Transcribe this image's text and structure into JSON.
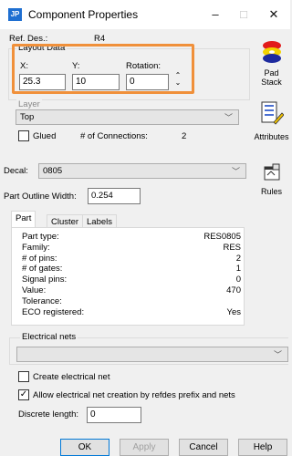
{
  "window": {
    "title": "Component Properties",
    "minimize": "–",
    "maximize": "□",
    "close": "✕"
  },
  "ref_des": {
    "label": "Ref. Des.:",
    "value": "R4"
  },
  "layout_data": {
    "label": "Layout Data",
    "x_label": "X:",
    "x_value": "25.3",
    "y_label": "Y:",
    "y_value": "10",
    "rotation_label": "Rotation:",
    "rotation_value": "0"
  },
  "layer": {
    "label": "Layer",
    "value": "Top"
  },
  "glued_label": "Glued",
  "connections": {
    "label": "# of Connections:",
    "value": "2"
  },
  "side_buttons": {
    "pad_stack": "Pad Stack",
    "attributes": "Attributes",
    "rules": "Rules"
  },
  "decal": {
    "label": "Decal:",
    "value": "0805"
  },
  "part_outline": {
    "label": "Part Outline Width:",
    "value": "0.254"
  },
  "tabs": [
    "Part",
    "Cluster",
    "Labels"
  ],
  "part_props": [
    {
      "label": "Part type:",
      "value": "RES0805"
    },
    {
      "label": "Family:",
      "value": "RES"
    },
    {
      "label": "# of pins:",
      "value": "2"
    },
    {
      "label": "# of gates:",
      "value": "1"
    },
    {
      "label": "Signal pins:",
      "value": "0"
    },
    {
      "label": "Value:",
      "value": "470"
    },
    {
      "label": "Tolerance:",
      "value": ""
    },
    {
      "label": "ECO registered:",
      "value": "Yes"
    }
  ],
  "electrical_nets": {
    "label": "Electrical nets",
    "value": ""
  },
  "create_net_label": "Create electrical net",
  "allow_net_label": "Allow electrical net creation by refdes prefix and nets",
  "discrete_length": {
    "label": "Discrete length:",
    "value": "0"
  },
  "buttons": {
    "ok": "OK",
    "apply": "Apply",
    "cancel": "Cancel",
    "help": "Help"
  },
  "colors": {
    "highlight": "#f0903a",
    "title_icon": "#1f6fd1"
  }
}
